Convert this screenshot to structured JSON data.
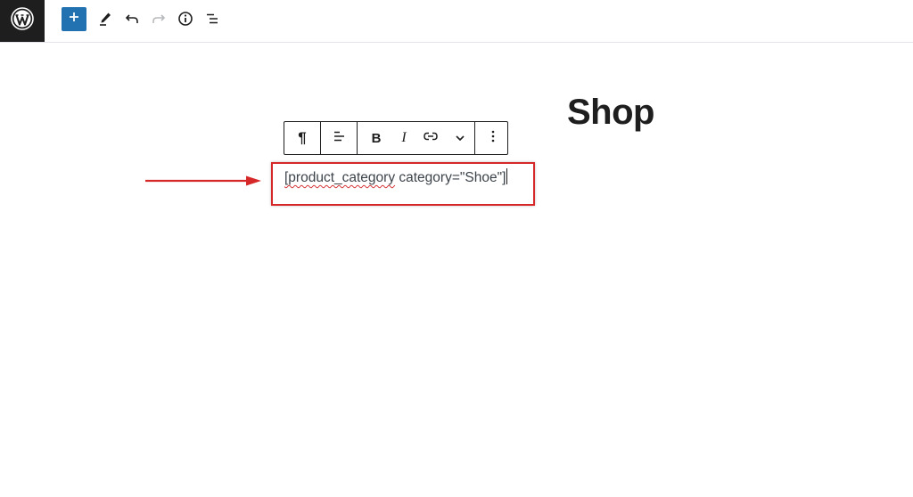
{
  "header": {
    "buttons": [
      {
        "name": "wordpress-logo",
        "icon": "wordpress-icon"
      },
      {
        "name": "add-block-button",
        "icon": "plus-icon"
      },
      {
        "name": "tools-button",
        "icon": "pencil-icon"
      },
      {
        "name": "undo-button",
        "icon": "undo-icon"
      },
      {
        "name": "redo-button",
        "icon": "redo-icon"
      },
      {
        "name": "details-button",
        "icon": "info-icon"
      },
      {
        "name": "list-view-button",
        "icon": "list-view-icon"
      }
    ]
  },
  "page": {
    "title": "Shop"
  },
  "block_toolbar": {
    "items": [
      "paragraph-icon",
      "align-icon",
      "bold-icon",
      "italic-icon",
      "link-icon",
      "chevron-down-icon",
      "more-options-icon"
    ],
    "bold_label": "B",
    "italic_label": "I",
    "paragraph_label": "¶"
  },
  "editor": {
    "shortcode_misspelled": "[product_category",
    "shortcode_rest": " category=\"Shoe\"]"
  },
  "colors": {
    "accent": "#2271b1",
    "annotation_red": "#d62828",
    "text_dark": "#1e1e1e"
  }
}
